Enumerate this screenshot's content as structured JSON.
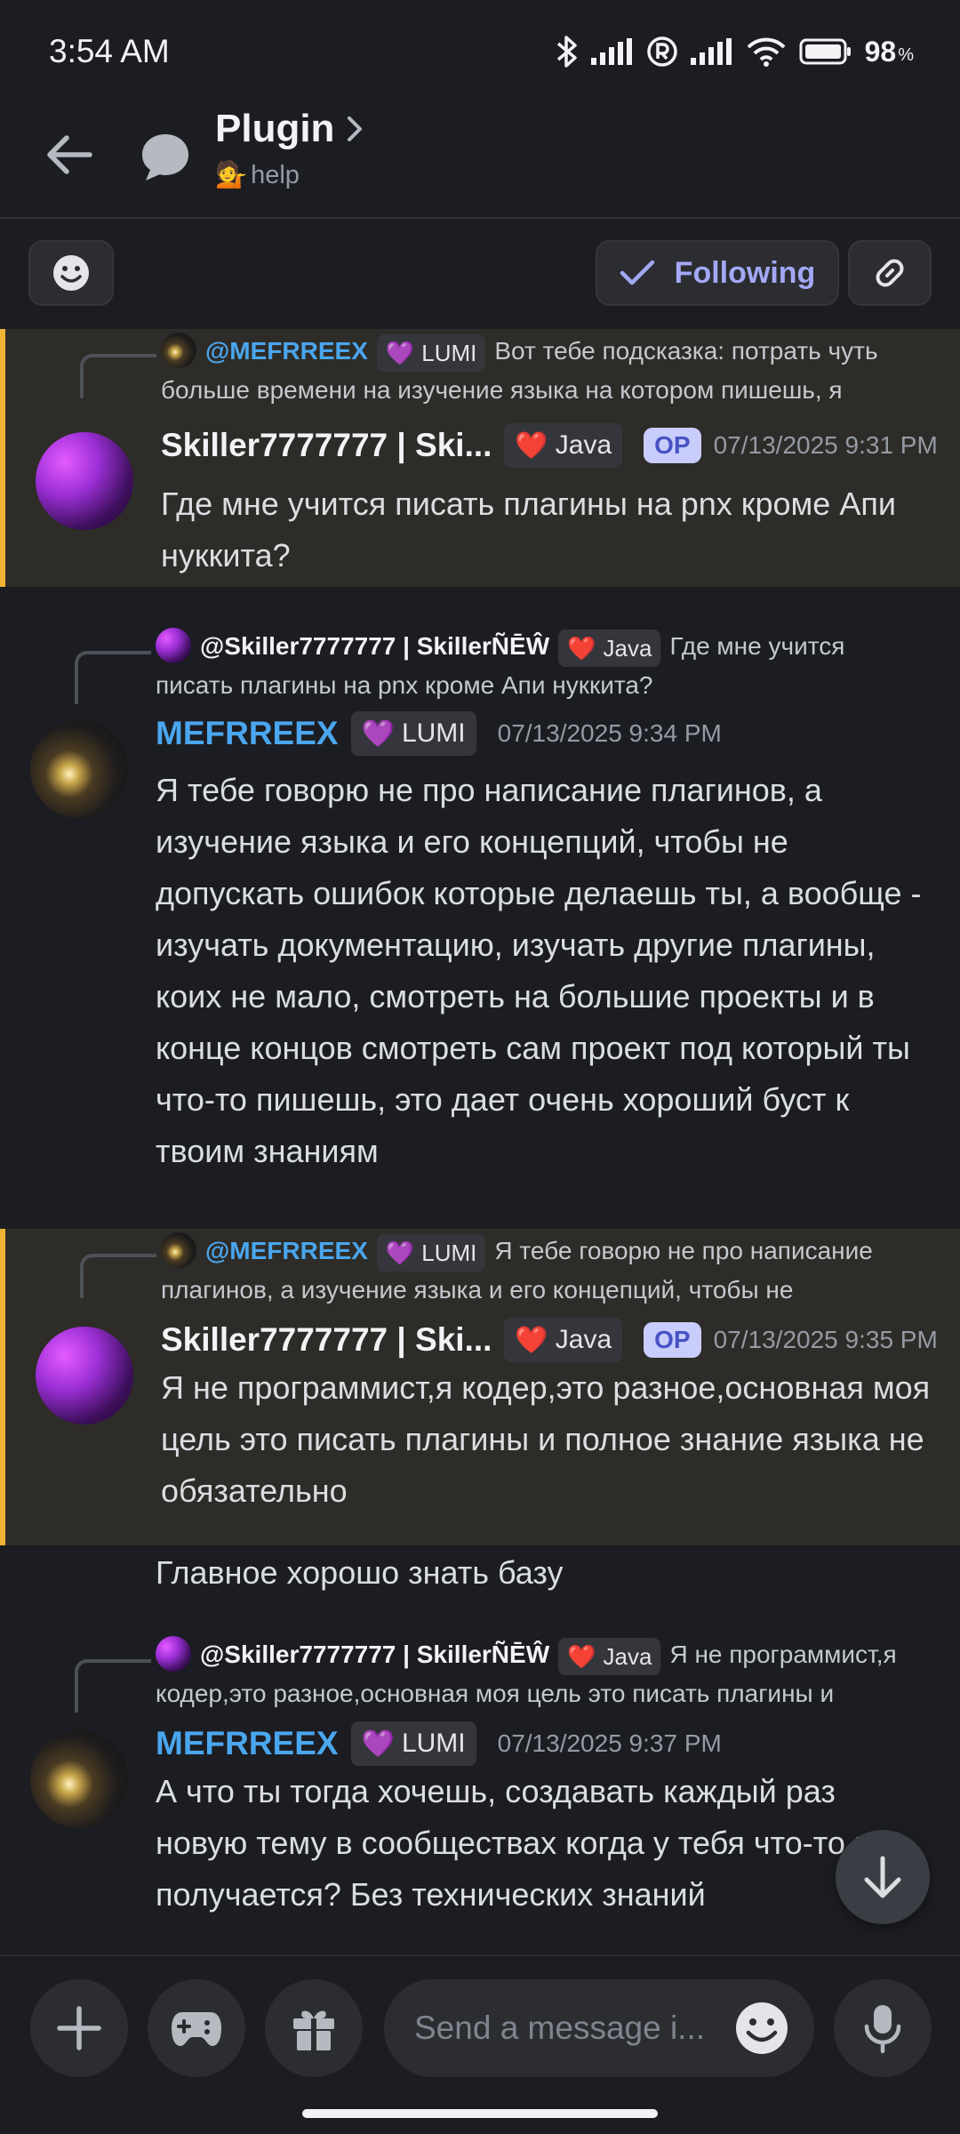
{
  "status": {
    "time": "3:54 AM",
    "battery": "98"
  },
  "header": {
    "title": "Plugin",
    "subtitle_emoji": "💁",
    "subtitle": "help"
  },
  "toolbar": {
    "following_label": "Following"
  },
  "messages": [
    {
      "reply": {
        "name": "@MEFRREEX",
        "tag": "LUMI",
        "text": "Вот тебе подсказка: потрать чуть больше времени на изучение языка на котором пишешь, я"
      },
      "author": "Skiller7777777 | Ski...",
      "tag": "Java",
      "op": "OP",
      "timestamp": "07/13/2025 9:31 PM",
      "body": "Где мне учится писать плагины на pnx кроме Апи нуккита?"
    },
    {
      "reply": {
        "name": "@Skiller7777777 | SkillerÑĒŴ",
        "tag": "Java",
        "text": "Где мне учится писать плагины на pnx кроме Апи нуккита?"
      },
      "author": "MEFRREEX",
      "tag": "LUMI",
      "timestamp": "07/13/2025 9:34 PM",
      "body": "Я тебе говорю не про написание плагинов, а изучение языка и его концепций, чтобы не допускать ошибок которые делаешь ты, а вообще - изучать документацию, изучать другие плагины, коих не мало, смотреть на большие проекты и в конце концов смотреть сам проект под который ты что-то пишешь, это дает очень хороший буст к твоим знаниям"
    },
    {
      "reply": {
        "name": "@MEFRREEX",
        "tag": "LUMI",
        "text": "Я тебе говорю не про написание плагинов, а изучение языка и его концепций, чтобы не"
      },
      "author": "Skiller7777777 | Ski...",
      "tag": "Java",
      "op": "OP",
      "timestamp": "07/13/2025 9:35 PM",
      "body": "Я не программист,я кодер,это разное,основная моя цель это писать плагины и полное знание языка не обязательно",
      "followup": "Главное хорошо знать базу"
    },
    {
      "reply": {
        "name": "@Skiller7777777 | SkillerÑĒŴ",
        "tag": "Java",
        "text": "Я не программист,я кодер,это разное,основная моя цель это писать плагины и"
      },
      "author": "MEFRREEX",
      "tag": "LUMI",
      "timestamp": "07/13/2025 9:37 PM",
      "body": "А что ты тогда хочешь, создавать каждый раз новую тему в сообществах когда у тебя что-то не получается? Без технических знаний"
    }
  ],
  "composer": {
    "placeholder": "Send a message i..."
  }
}
